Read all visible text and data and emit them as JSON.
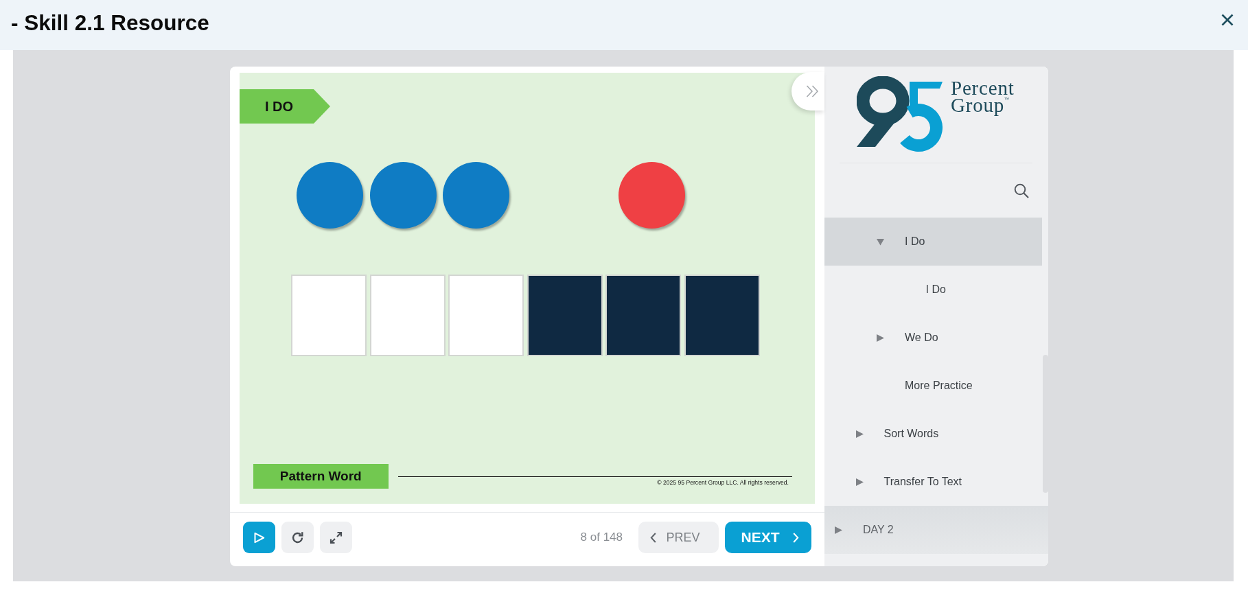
{
  "header": {
    "title": "- Skill 2.1 Resource"
  },
  "slide": {
    "banner": "I DO",
    "counter_groups": [
      {
        "counters": [
          {
            "color": "#0f7cc4"
          },
          {
            "color": "#0f7cc4"
          },
          {
            "color": "#0f7cc4"
          }
        ]
      },
      {
        "counters": [
          {
            "color": "#ef4044"
          }
        ]
      }
    ],
    "boxes": [
      {
        "color": "#ffffff"
      },
      {
        "color": "#ffffff"
      },
      {
        "color": "#ffffff"
      },
      {
        "color": "#0f2942"
      },
      {
        "color": "#0f2942"
      },
      {
        "color": "#0f2942"
      }
    ],
    "pattern_label": "Pattern Word",
    "copyright": "© 2025 95 Percent Group LLC. All rights reserved."
  },
  "controls": {
    "page_counter": "8 of 148",
    "prev": "PREV",
    "next": "NEXT"
  },
  "sidebar": {
    "logo": {
      "lines": [
        "Percent",
        "Group$^{™}$"
      ]
    },
    "outline": [
      {
        "children": [
          {
            "children": [
              {
                "label": "I Do",
                "selected": true,
                "expanded": true,
                "children": [
                  {
                    "label": "I Do",
                    "selected": false
                  }
                ]
              },
              {
                "label": "We Do",
                "selected": false,
                "expanded": false
              },
              {
                "label": "More Practice",
                "selected": false
              }
            ]
          },
          {
            "label": "Sort Words",
            "selected": false,
            "expanded": false
          },
          {
            "label": "Transfer To Text",
            "selected": false,
            "expanded": false
          }
        ]
      },
      {
        "label": "DAY 2",
        "selected": false,
        "expanded": false
      }
    ]
  }
}
